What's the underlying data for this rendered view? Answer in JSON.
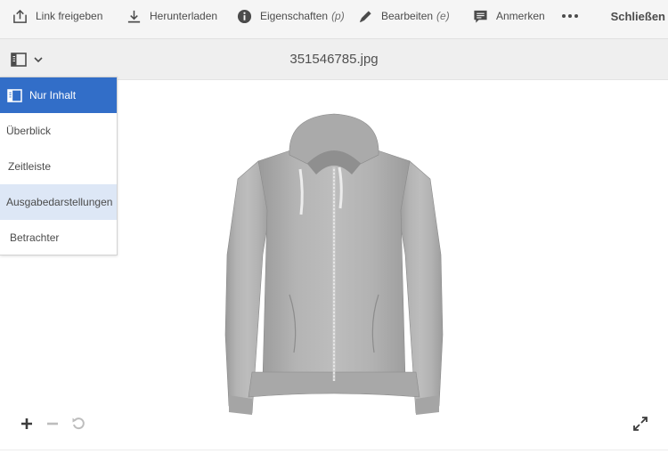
{
  "toolbar": {
    "share_label": "Link freigeben",
    "download_label": "Herunterladen",
    "properties_label": "Eigenschaften",
    "properties_shortcut": "(p)",
    "edit_label": "Bearbeiten",
    "edit_shortcut": "(e)",
    "annotate_label": "Anmerken",
    "more_icon": "more-icon",
    "close_label": "Schließen"
  },
  "titlebar": {
    "title": "351546785.jpg",
    "rail_toggle_icon": "panel-icon"
  },
  "rail_menu": {
    "items": [
      {
        "label": "Nur Inhalt",
        "state": "selected"
      },
      {
        "label": "Überblick",
        "state": "normal"
      },
      {
        "label": "Zeitleiste",
        "state": "normal"
      },
      {
        "label": "Ausgabedarstellungen",
        "state": "hover"
      },
      {
        "label": "Betrachter",
        "state": "normal"
      }
    ]
  },
  "viewer": {
    "image_subject": "grey zip hoodie",
    "controls": [
      "zoom-in-icon",
      "zoom-out-icon",
      "reset-icon",
      "fullscreen-icon"
    ]
  },
  "colors": {
    "toolbar_bg": "#f5f5f5",
    "titlebar_bg": "#efefef",
    "selected_bg": "#326ec8",
    "hover_bg": "#dde7f6",
    "text": "#4b4b4b"
  }
}
